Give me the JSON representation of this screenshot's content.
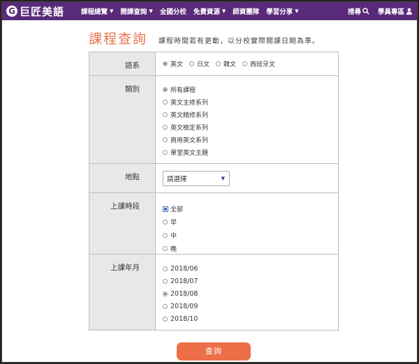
{
  "nav": {
    "logo_mark": "G",
    "logo_text": "巨匠美語",
    "menu": [
      {
        "label": "課程總覽",
        "caret": "▼"
      },
      {
        "label": "開課查詢",
        "caret": "▼"
      },
      {
        "label": "全國分校",
        "caret": ""
      },
      {
        "label": "免費資源",
        "caret": "▼"
      },
      {
        "label": "師資團隊",
        "caret": ""
      },
      {
        "label": "學習分享",
        "caret": "▼"
      }
    ],
    "search_label": "搜尋",
    "member_label": "學員專區"
  },
  "header": {
    "title": "課程查詢",
    "note": "課程時間若有更動，以分校實際開課日期為準。"
  },
  "form": {
    "language": {
      "label": "語系",
      "options": [
        {
          "text": "英文",
          "checked": true
        },
        {
          "text": "日文",
          "checked": false
        },
        {
          "text": "韓文",
          "checked": false
        },
        {
          "text": "西班牙文",
          "checked": false
        }
      ]
    },
    "category": {
      "label": "類別",
      "options": [
        {
          "text": "所有課程",
          "checked": true
        },
        {
          "text": "英文主修系列",
          "checked": false
        },
        {
          "text": "英文精修系列",
          "checked": false
        },
        {
          "text": "英文檢定系列",
          "checked": false
        },
        {
          "text": "商用英文系列",
          "checked": false
        },
        {
          "text": "單堂英文主題",
          "checked": false
        }
      ]
    },
    "location": {
      "label": "地點",
      "selected": "請選擇",
      "caret": "▼"
    },
    "time": {
      "label": "上課時段",
      "options": [
        {
          "text": "全部",
          "checked": true
        },
        {
          "text": "早",
          "checked": false
        },
        {
          "text": "中",
          "checked": false
        },
        {
          "text": "晚",
          "checked": false
        }
      ]
    },
    "month": {
      "label": "上課年月",
      "options": [
        {
          "text": "2018/06",
          "checked": false
        },
        {
          "text": "2018/07",
          "checked": false
        },
        {
          "text": "2018/08",
          "checked": true
        },
        {
          "text": "2018/09",
          "checked": false
        },
        {
          "text": "2018/10",
          "checked": false
        }
      ]
    }
  },
  "submit_label": "查詢"
}
